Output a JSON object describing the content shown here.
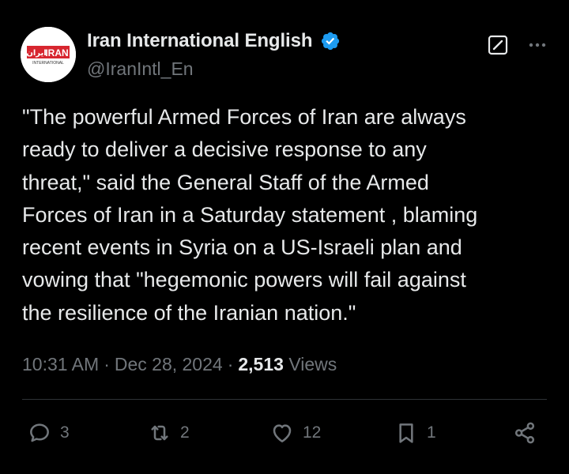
{
  "author": {
    "display_name": "Iran International English",
    "handle": "@IranIntl_En",
    "verified": true,
    "avatar_icon": "iran-international-logo",
    "avatar_logo_text": "IRAN",
    "avatar_logo_subtext": "INTERNATIONAL",
    "brand_color": "#d7262f"
  },
  "tweet": {
    "text": "\"The powerful Armed Forces of Iran are always\nready to deliver a decisive response to any\nthreat,\" said the General Staff of the Armed\nForces of Iran in a Saturday statement , blaming\nrecent events in Syria on a US-Israeli plan and\nvowing that \"hegemonic powers will fail against\nthe resilience of the Iranian nation.\"",
    "time": "10:31 AM",
    "date": "Dec 28, 2024",
    "separator": "·",
    "views_count": "2,513",
    "views_label": "Views"
  },
  "actions": {
    "replies": "3",
    "reposts": "2",
    "likes": "12",
    "bookmarks": "1"
  },
  "colors": {
    "background": "#000000",
    "text_primary": "#e7e9ea",
    "text_secondary": "#71767b",
    "verified_blue": "#1d9bf0",
    "divider": "#2f3336"
  }
}
